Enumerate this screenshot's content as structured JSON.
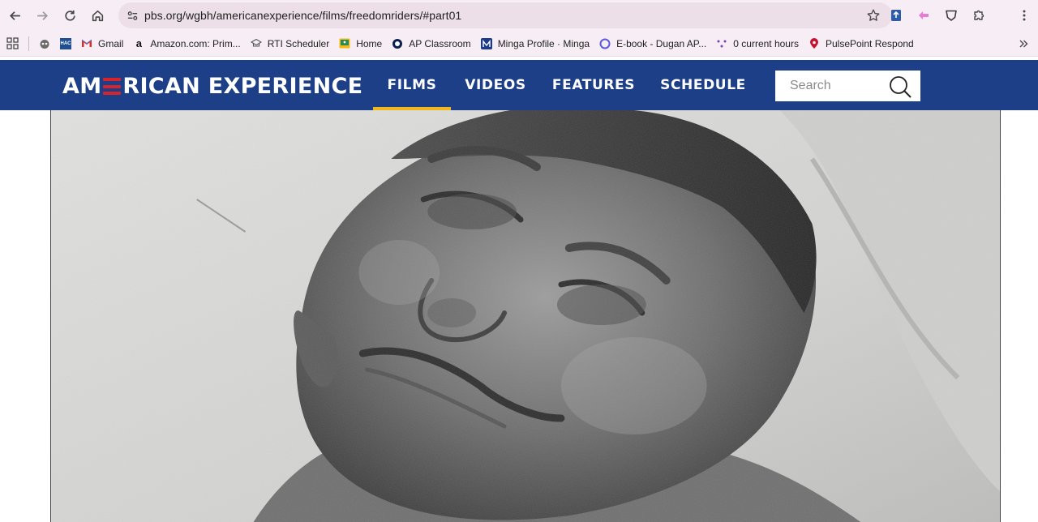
{
  "browser": {
    "url": "pbs.org/wgbh/americanexperience/films/freedomriders/#part01",
    "bookmarks": [
      {
        "label": "",
        "icon": "raccoon-icon"
      },
      {
        "label": "",
        "icon": "hac-icon",
        "badge": "HAC"
      },
      {
        "label": "Gmail",
        "icon": "gmail-icon"
      },
      {
        "label": "Amazon.com: Prim...",
        "icon": "amazon-icon"
      },
      {
        "label": "RTI Scheduler",
        "icon": "rti-icon"
      },
      {
        "label": "Home",
        "icon": "classroom-icon"
      },
      {
        "label": "AP Classroom",
        "icon": "ap-icon"
      },
      {
        "label": "Minga Profile · Minga",
        "icon": "minga-icon"
      },
      {
        "label": "E-book - Dugan AP...",
        "icon": "ebook-icon"
      },
      {
        "label": "0 current hours",
        "icon": "hours-icon"
      },
      {
        "label": "PulsePoint Respond",
        "icon": "pulsepoint-icon"
      }
    ]
  },
  "site": {
    "logo_left": "AM",
    "logo_right": "RICAN EXPERIENCE",
    "nav": [
      {
        "label": "FILMS",
        "active": true
      },
      {
        "label": "VIDEOS",
        "active": false
      },
      {
        "label": "FEATURES",
        "active": false
      },
      {
        "label": "SCHEDULE",
        "active": false
      }
    ],
    "search_placeholder": "Search"
  },
  "colors": {
    "header_bg": "#1c3f88",
    "active_underline": "#f2b51b",
    "logo_accent": "#d8232a",
    "chrome_bg": "#f6eef4"
  }
}
